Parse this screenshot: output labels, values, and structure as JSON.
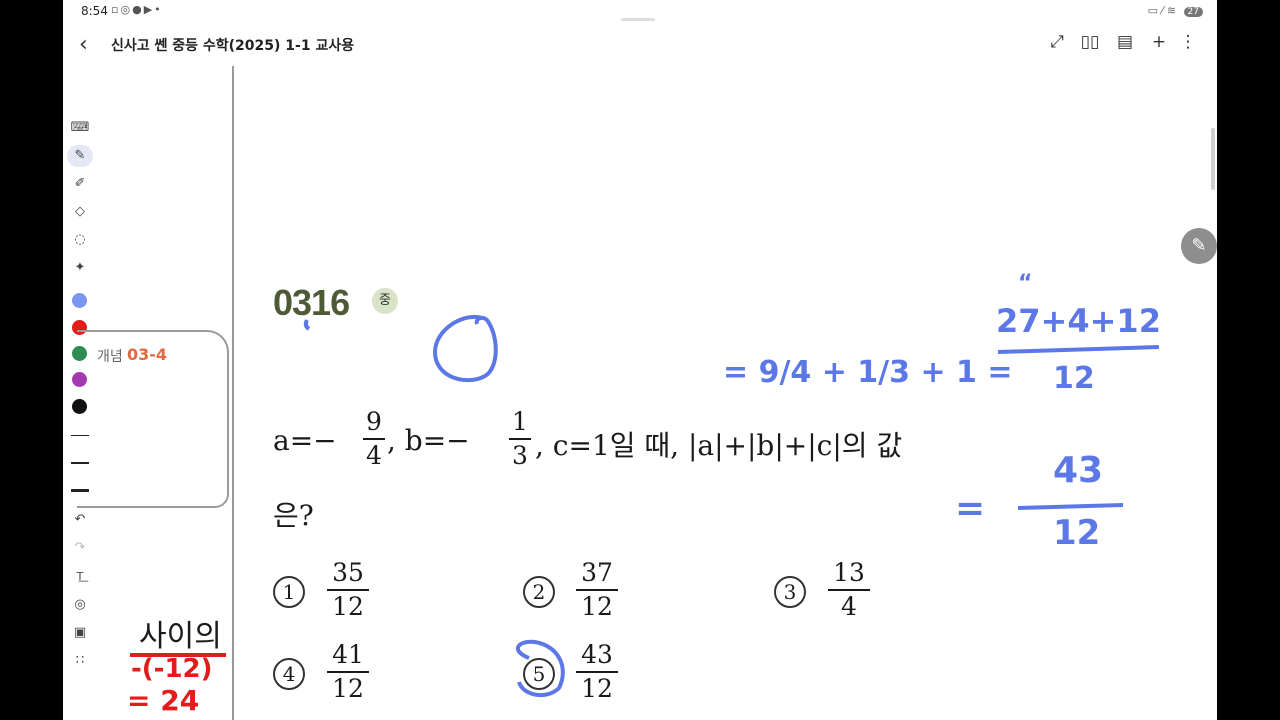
{
  "status_bar": {
    "time": "8:54",
    "left_icons": [
      "notification-icon",
      "media-icon",
      "github-icon",
      "youtube-icon",
      "dot-icon"
    ],
    "battery": "27"
  },
  "header": {
    "back_icon": "‹",
    "title": "신사고 쎈 중등 수학(2025) 1-1 교사용",
    "tools": [
      "expand-icon",
      "book-icon",
      "document-icon",
      "add-icon",
      "more-icon"
    ]
  },
  "toolbar": {
    "tools": [
      "keyboard-icon",
      "pen-icon",
      "highlighter-icon",
      "eraser-icon",
      "lasso-icon",
      "magic-icon"
    ],
    "colors": [
      "#7c95ee",
      "#e21b1b",
      "#2c8c52",
      "#a33ab0",
      "#111111"
    ],
    "line_widths": [
      "thin",
      "medium",
      "thick"
    ],
    "actions": [
      "undo-icon",
      "redo-icon",
      "text-icon",
      "shapes-icon",
      "image-icon",
      "grid-icon"
    ]
  },
  "concept_box": {
    "label": "개념",
    "code": "03-4"
  },
  "question": {
    "number": "0316",
    "level": "중",
    "text_a": "a=−",
    "text_b": ", b=−",
    "text_c": ", c=1일 때, |a|+|b|+|c|의 값",
    "line2": "은?",
    "fraction_a": {
      "num": "9",
      "den": "4"
    },
    "fraction_b": {
      "num": "1",
      "den": "3"
    }
  },
  "choices": [
    {
      "mark": "①",
      "num": "35",
      "den": "12"
    },
    {
      "mark": "②",
      "num": "37",
      "den": "12"
    },
    {
      "mark": "③",
      "num": "13",
      "den": "4"
    },
    {
      "mark": "④",
      "num": "41",
      "den": "12"
    },
    {
      "mark": "⑤",
      "num": "43",
      "den": "12"
    }
  ],
  "handwriting": {
    "blue_line1_left": "= 9/4 + 1/3 + 1 =",
    "blue_line1_num": "27+4+12",
    "blue_line1_den": "12",
    "blue_line2_num": "43",
    "blue_line2_den": "12",
    "side_text": "사이의",
    "red_line1": "-(-12)",
    "red_line2": "= 24"
  },
  "colors": {
    "ink_blue": "#5b78e6",
    "ink_red": "#e21b1b",
    "qnum": "#4e5a36",
    "concept_code": "#e06a3e"
  }
}
